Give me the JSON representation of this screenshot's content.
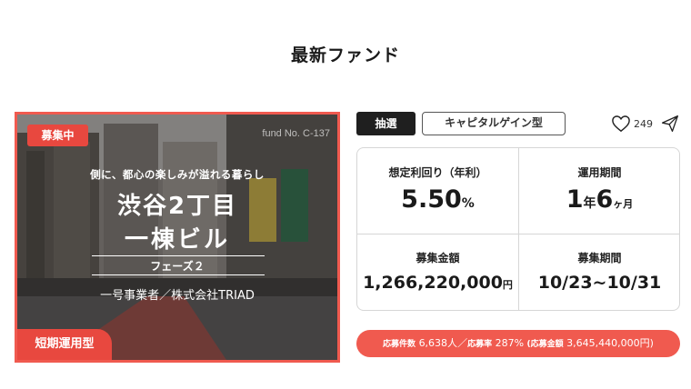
{
  "section": {
    "title": "最新ファンド"
  },
  "hero": {
    "status_badge": "募集中",
    "fund_no": "fund No. C-137",
    "tagline": "側に、都心の楽しみが溢れる暮らし",
    "title_line1": "渋谷2丁目",
    "title_line2": "一棟ビル",
    "phase": "フェーズ２",
    "operator": "一号事業者／株式会社TRIAD",
    "term_badge": "短期運用型"
  },
  "tags": {
    "lottery": "抽選",
    "capital_gain": "キャピタルゲイン型"
  },
  "actions": {
    "like_icon": "heart-icon",
    "like_count": "249",
    "share_icon": "paper-plane-icon"
  },
  "stats": {
    "yield": {
      "label": "想定利回り（年利）",
      "value": "5.50",
      "unit": "%"
    },
    "period": {
      "label": "運用期間",
      "years": "1",
      "year_unit": "年",
      "months": "6",
      "month_unit": "ヶ月"
    },
    "amount": {
      "label": "募集金額",
      "value": "1,266,220,000",
      "unit": "円"
    },
    "recruit_period": {
      "label": "募集期間",
      "value": "10/23~10/31"
    }
  },
  "application": {
    "count_label": "応募件数",
    "count_value": "6,638人",
    "sep": "／",
    "rate_label": "応募率",
    "rate_value": "287%",
    "amount_label": "(応募金額",
    "amount_value": "3,645,440,000円)"
  },
  "colors": {
    "accent": "#f05a4f",
    "dark": "#1f1f1f"
  }
}
